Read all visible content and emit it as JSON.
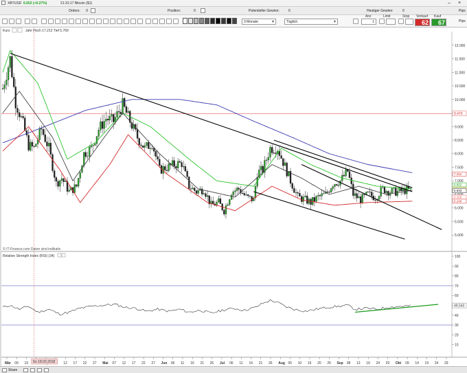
{
  "header": {
    "symbol": "XBTUSD",
    "quote": "6.652 (+0.27%)",
    "quote_color": "#1aa31a",
    "timestamp": "21:31:17 Bitcoin ($1)"
  },
  "toolbar": {
    "orders_label": "Orders:",
    "orders_value": "0",
    "position_label": "Position:",
    "position_value": "0",
    "potential_label": "Potentieller Gewinn:",
    "potential_value": "0",
    "today_gain_label": "Heutiger Gewinn:",
    "today_gain_value": "0",
    "right_units": [
      "Pips",
      "Pips"
    ]
  },
  "chart_settings": {
    "range": "3 Monate",
    "interval": "Täglich"
  },
  "order_panel": {
    "anz_label": "Anz",
    "anz_value": "1",
    "limit_label": "Limit",
    "stop_label": "Stop",
    "verkauf_label": "Verkauf",
    "verkauf_big": "62",
    "verkauf_color": "#d42a2a",
    "kauf_label": "Kauf",
    "kauf_big": "67",
    "kauf_color": "#2a9a2a"
  },
  "main_panel": {
    "title": "Kurs",
    "legend": "Jahr Hoch 17.212 Tief 5.769",
    "credit": "© IT-Finance.com Daten sind indikativ",
    "price_ticks": [
      "12.000",
      "11.500",
      "11.000",
      "10.500",
      "10.000",
      "9.500",
      "9.000",
      "8.500",
      "8.000",
      "7.500",
      "7.000",
      "6.500",
      "6.000",
      "5.500",
      "5.000"
    ],
    "price_tag_label": "9.470",
    "price_tag_value": 9470,
    "tag_colors": [
      "#d42a2a",
      "#0aa00a",
      "#e0a000",
      "#1a1a1a",
      "#ff6a6a"
    ],
    "last_tags": [
      "7.252",
      "6.852",
      "6.681",
      "6.633",
      "6.398",
      "6.248"
    ]
  },
  "rsi_panel": {
    "title": "Relative Strength Index (RSI) (34)",
    "ticks": [
      "100",
      "90",
      "80",
      "70",
      "60",
      "50",
      "40",
      "30",
      "20",
      "10"
    ],
    "last_value": "49,543",
    "levels": [
      70,
      30
    ]
  },
  "x_axis": {
    "labels": [
      "Mär",
      "09",
      "19",
      "28",
      "Apr",
      "07",
      "12",
      "17",
      "22",
      "27",
      "Mai",
      "07",
      "12",
      "17",
      "22",
      "27",
      "Jun",
      "06",
      "11",
      "16",
      "21",
      "26",
      "Jul",
      "06",
      "11",
      "16",
      "21",
      "26",
      "Aug",
      "05",
      "10",
      "15",
      "20",
      "25",
      "Sep",
      "08",
      "13",
      "19",
      "24",
      "29",
      "Okt",
      "09",
      "14",
      "19",
      "24",
      "29"
    ],
    "cursor_label": "So 18.03.2018"
  },
  "icons": [
    "home-icon",
    "print-icon",
    "camera-icon",
    "zoom-in-icon",
    "zoom-out-icon",
    "crosshair-icon",
    "trendline-icon",
    "rectangle-icon",
    "text-tool-icon",
    "fibonacci-icon",
    "settings-icon",
    "close-icon",
    "minimize-icon"
  ],
  "chart_data": {
    "type": "candlestick",
    "symbol": "XBTUSD",
    "ylim": [
      4600,
      12400
    ],
    "y_unit": "USD",
    "x_start": "2018-03-01",
    "x_end": "2018-10-29",
    "close_series": [
      {
        "date": "2018-03-01",
        "value": 10400
      },
      {
        "date": "2018-03-05",
        "value": 11500
      },
      {
        "date": "2018-03-08",
        "value": 9900
      },
      {
        "date": "2018-03-12",
        "value": 9100
      },
      {
        "date": "2018-03-15",
        "value": 8300
      },
      {
        "date": "2018-03-18",
        "value": 8200
      },
      {
        "date": "2018-03-22",
        "value": 8900
      },
      {
        "date": "2018-03-26",
        "value": 8200
      },
      {
        "date": "2018-03-30",
        "value": 6900
      },
      {
        "date": "2018-04-02",
        "value": 7100
      },
      {
        "date": "2018-04-06",
        "value": 6600
      },
      {
        "date": "2018-04-10",
        "value": 6800
      },
      {
        "date": "2018-04-14",
        "value": 8000
      },
      {
        "date": "2018-04-18",
        "value": 8200
      },
      {
        "date": "2018-04-22",
        "value": 8900
      },
      {
        "date": "2018-04-26",
        "value": 9300
      },
      {
        "date": "2018-04-30",
        "value": 9200
      },
      {
        "date": "2018-05-05",
        "value": 9800
      },
      {
        "date": "2018-05-09",
        "value": 9200
      },
      {
        "date": "2018-05-13",
        "value": 8600
      },
      {
        "date": "2018-05-17",
        "value": 8200
      },
      {
        "date": "2018-05-21",
        "value": 8400
      },
      {
        "date": "2018-05-25",
        "value": 7400
      },
      {
        "date": "2018-05-29",
        "value": 7500
      },
      {
        "date": "2018-06-02",
        "value": 7600
      },
      {
        "date": "2018-06-06",
        "value": 7650
      },
      {
        "date": "2018-06-10",
        "value": 6800
      },
      {
        "date": "2018-06-14",
        "value": 6600
      },
      {
        "date": "2018-06-18",
        "value": 6700
      },
      {
        "date": "2018-06-22",
        "value": 6100
      },
      {
        "date": "2018-06-26",
        "value": 6200
      },
      {
        "date": "2018-06-29",
        "value": 5900
      },
      {
        "date": "2018-07-03",
        "value": 6600
      },
      {
        "date": "2018-07-07",
        "value": 6700
      },
      {
        "date": "2018-07-11",
        "value": 6400
      },
      {
        "date": "2018-07-15",
        "value": 6300
      },
      {
        "date": "2018-07-17",
        "value": 7300
      },
      {
        "date": "2018-07-20",
        "value": 7400
      },
      {
        "date": "2018-07-24",
        "value": 8200
      },
      {
        "date": "2018-07-28",
        "value": 8200
      },
      {
        "date": "2018-07-31",
        "value": 7700
      },
      {
        "date": "2018-08-04",
        "value": 7000
      },
      {
        "date": "2018-08-08",
        "value": 6400
      },
      {
        "date": "2018-08-12",
        "value": 6300
      },
      {
        "date": "2018-08-15",
        "value": 6200
      },
      {
        "date": "2018-08-19",
        "value": 6400
      },
      {
        "date": "2018-08-23",
        "value": 6500
      },
      {
        "date": "2018-08-27",
        "value": 6900
      },
      {
        "date": "2018-08-31",
        "value": 7000
      },
      {
        "date": "2018-09-04",
        "value": 7350
      },
      {
        "date": "2018-09-07",
        "value": 6500
      },
      {
        "date": "2018-09-11",
        "value": 6300
      },
      {
        "date": "2018-09-15",
        "value": 6500
      },
      {
        "date": "2018-09-19",
        "value": 6400
      },
      {
        "date": "2018-09-23",
        "value": 6700
      },
      {
        "date": "2018-09-27",
        "value": 6600
      },
      {
        "date": "2018-10-01",
        "value": 6600
      },
      {
        "date": "2018-10-05",
        "value": 6650
      },
      {
        "date": "2018-10-08",
        "value": 6652
      }
    ],
    "moving_averages": [
      {
        "name": "MA slow",
        "color": "#3b3bb0",
        "points": [
          {
            "date": "2018-03-01",
            "value": 8400
          },
          {
            "date": "2018-03-20",
            "value": 8900
          },
          {
            "date": "2018-04-15",
            "value": 9600
          },
          {
            "date": "2018-05-10",
            "value": 10000
          },
          {
            "date": "2018-06-05",
            "value": 10000
          },
          {
            "date": "2018-06-25",
            "value": 9800
          },
          {
            "date": "2018-07-15",
            "value": 9200
          },
          {
            "date": "2018-08-05",
            "value": 8600
          },
          {
            "date": "2018-08-25",
            "value": 8000
          },
          {
            "date": "2018-09-15",
            "value": 7600
          },
          {
            "date": "2018-10-09",
            "value": 7300
          }
        ]
      },
      {
        "name": "MA mid",
        "color": "#2ec42e",
        "points": [
          {
            "date": "2018-03-01",
            "value": 11000
          },
          {
            "date": "2018-03-05",
            "value": 11800
          },
          {
            "date": "2018-03-20",
            "value": 10600
          },
          {
            "date": "2018-04-05",
            "value": 7800
          },
          {
            "date": "2018-04-20",
            "value": 8400
          },
          {
            "date": "2018-05-05",
            "value": 9500
          },
          {
            "date": "2018-05-20",
            "value": 9000
          },
          {
            "date": "2018-06-10",
            "value": 7800
          },
          {
            "date": "2018-06-25",
            "value": 7000
          },
          {
            "date": "2018-07-15",
            "value": 6800
          },
          {
            "date": "2018-07-30",
            "value": 8200
          },
          {
            "date": "2018-08-15",
            "value": 7600
          },
          {
            "date": "2018-09-01",
            "value": 7100
          },
          {
            "date": "2018-09-20",
            "value": 6800
          },
          {
            "date": "2018-10-09",
            "value": 6700
          }
        ]
      },
      {
        "name": "MA fast",
        "color": "#444444",
        "points": [
          {
            "date": "2018-03-01",
            "value": 9500
          },
          {
            "date": "2018-03-10",
            "value": 10300
          },
          {
            "date": "2018-03-28",
            "value": 8600
          },
          {
            "date": "2018-04-08",
            "value": 7000
          },
          {
            "date": "2018-04-25",
            "value": 8600
          },
          {
            "date": "2018-05-05",
            "value": 9500
          },
          {
            "date": "2018-05-25",
            "value": 8000
          },
          {
            "date": "2018-06-15",
            "value": 6700
          },
          {
            "date": "2018-07-05",
            "value": 6400
          },
          {
            "date": "2018-07-25",
            "value": 7600
          },
          {
            "date": "2018-08-10",
            "value": 7100
          },
          {
            "date": "2018-08-25",
            "value": 6500
          },
          {
            "date": "2018-09-10",
            "value": 6800
          },
          {
            "date": "2018-09-25",
            "value": 6500
          },
          {
            "date": "2018-10-09",
            "value": 6650
          }
        ]
      },
      {
        "name": "MA lower",
        "color": "#d42a2a",
        "points": [
          {
            "date": "2018-03-01",
            "value": 8100
          },
          {
            "date": "2018-03-15",
            "value": 9000
          },
          {
            "date": "2018-04-01",
            "value": 7400
          },
          {
            "date": "2018-04-12",
            "value": 6200
          },
          {
            "date": "2018-04-28",
            "value": 7600
          },
          {
            "date": "2018-05-08",
            "value": 8700
          },
          {
            "date": "2018-05-28",
            "value": 7300
          },
          {
            "date": "2018-06-20",
            "value": 6200
          },
          {
            "date": "2018-07-05",
            "value": 5900
          },
          {
            "date": "2018-07-25",
            "value": 6800
          },
          {
            "date": "2018-08-10",
            "value": 6300
          },
          {
            "date": "2018-08-28",
            "value": 6100
          },
          {
            "date": "2018-09-15",
            "value": 6200
          },
          {
            "date": "2018-10-09",
            "value": 6250
          }
        ]
      }
    ],
    "trendlines": [
      {
        "name": "main downtrend",
        "from": {
          "date": "2018-03-05",
          "value": 11700
        },
        "to": {
          "date": "2018-10-09",
          "value": 6600
        }
      },
      {
        "name": "channel upper",
        "from": {
          "date": "2018-07-26",
          "value": 8500
        },
        "to": {
          "date": "2018-10-09",
          "value": 6750
        }
      },
      {
        "name": "channel lower",
        "from": {
          "date": "2018-07-15",
          "value": 6600
        },
        "to": {
          "date": "2018-10-05",
          "value": 4850
        }
      },
      {
        "name": "parallel support",
        "from": {
          "date": "2018-08-10",
          "value": 7600
        },
        "to": {
          "date": "2018-10-25",
          "value": 5200
        }
      }
    ],
    "rsi": {
      "period": 34,
      "ylim": [
        0,
        100
      ],
      "levels": [
        70,
        30
      ],
      "points": [
        {
          "date": "2018-03-01",
          "value": 48
        },
        {
          "date": "2018-03-05",
          "value": 50
        },
        {
          "date": "2018-03-10",
          "value": 46
        },
        {
          "date": "2018-03-15",
          "value": 49
        },
        {
          "date": "2018-03-20",
          "value": 43
        },
        {
          "date": "2018-03-26",
          "value": 46
        },
        {
          "date": "2018-04-01",
          "value": 41
        },
        {
          "date": "2018-04-06",
          "value": 43
        },
        {
          "date": "2018-04-12",
          "value": 47
        },
        {
          "date": "2018-04-18",
          "value": 49
        },
        {
          "date": "2018-04-24",
          "value": 50
        },
        {
          "date": "2018-05-01",
          "value": 51
        },
        {
          "date": "2018-05-06",
          "value": 48
        },
        {
          "date": "2018-05-12",
          "value": 47
        },
        {
          "date": "2018-05-18",
          "value": 44
        },
        {
          "date": "2018-05-24",
          "value": 46
        },
        {
          "date": "2018-05-30",
          "value": 44
        },
        {
          "date": "2018-06-05",
          "value": 46
        },
        {
          "date": "2018-06-10",
          "value": 43
        },
        {
          "date": "2018-06-16",
          "value": 45
        },
        {
          "date": "2018-06-22",
          "value": 42
        },
        {
          "date": "2018-06-28",
          "value": 45
        },
        {
          "date": "2018-07-04",
          "value": 47
        },
        {
          "date": "2018-07-10",
          "value": 45
        },
        {
          "date": "2018-07-16",
          "value": 48
        },
        {
          "date": "2018-07-20",
          "value": 52
        },
        {
          "date": "2018-07-24",
          "value": 55
        },
        {
          "date": "2018-07-28",
          "value": 53
        },
        {
          "date": "2018-08-01",
          "value": 49
        },
        {
          "date": "2018-08-06",
          "value": 46
        },
        {
          "date": "2018-08-12",
          "value": 44
        },
        {
          "date": "2018-08-18",
          "value": 46
        },
        {
          "date": "2018-08-24",
          "value": 48
        },
        {
          "date": "2018-08-30",
          "value": 49
        },
        {
          "date": "2018-09-04",
          "value": 50
        },
        {
          "date": "2018-09-08",
          "value": 46
        },
        {
          "date": "2018-09-14",
          "value": 47
        },
        {
          "date": "2018-09-20",
          "value": 46
        },
        {
          "date": "2018-09-26",
          "value": 48
        },
        {
          "date": "2018-10-02",
          "value": 49
        },
        {
          "date": "2018-10-08",
          "value": 49.5
        }
      ],
      "trendline": {
        "from": {
          "date": "2018-09-08",
          "value": 43
        },
        "to": {
          "date": "2018-10-23",
          "value": 51
        }
      },
      "last_value": 49.543
    }
  }
}
